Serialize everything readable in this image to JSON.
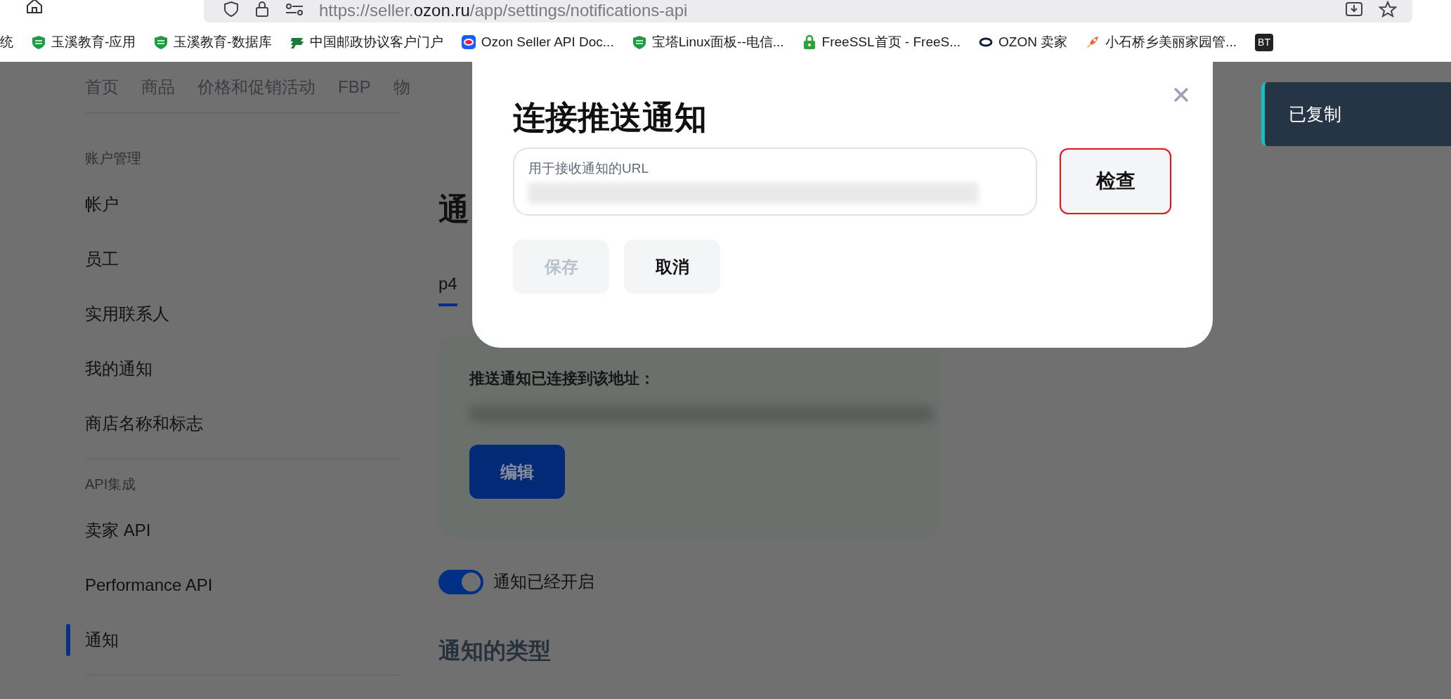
{
  "browser": {
    "url": {
      "prefix": "https://seller.",
      "domain": "ozon.ru",
      "path": "/app/settings/notifications-api"
    }
  },
  "bookmarks": [
    {
      "label": "统",
      "kind": "none"
    },
    {
      "label": "玉溪教育-应用",
      "kind": "shield"
    },
    {
      "label": "玉溪教育-数据库",
      "kind": "shield"
    },
    {
      "label": "中国邮政协议客户门户",
      "kind": "post"
    },
    {
      "label": "Ozon Seller API Doc...",
      "kind": "app"
    },
    {
      "label": "宝塔Linux面板--电信...",
      "kind": "shield"
    },
    {
      "label": "FreeSSL首页 - FreeS...",
      "kind": "lock"
    },
    {
      "label": "OZON 卖家",
      "kind": "ring"
    },
    {
      "label": "小石桥乡美丽家园管...",
      "kind": "rocket"
    },
    {
      "label": "BT",
      "kind": "tile"
    }
  ],
  "top_nav": [
    "首页",
    "商品",
    "价格和促销活动",
    "FBP",
    "物"
  ],
  "sidebar": [
    {
      "heading": "账户管理",
      "items": [
        {
          "label": "帐户",
          "selected": false
        },
        {
          "label": "员工",
          "selected": false
        },
        {
          "label": "实用联系人",
          "selected": false
        },
        {
          "label": "我的通知",
          "selected": false
        },
        {
          "label": "商店名称和标志",
          "selected": false
        }
      ]
    },
    {
      "heading": "API集成",
      "items": [
        {
          "label": "卖家 API",
          "selected": false
        },
        {
          "label": "Performance API",
          "selected": false
        },
        {
          "label": "通知",
          "selected": true
        }
      ]
    }
  ],
  "page": {
    "title": "通",
    "tabs": [
      {
        "label": "p4",
        "selected": true
      }
    ],
    "card": {
      "heading": "推送通知已连接到该地址：",
      "button": "编辑"
    },
    "toggle": {
      "label": "通知已经开启",
      "on": true
    },
    "section_title": "通知的类型"
  },
  "modal": {
    "title": "连接推送通知",
    "field": {
      "label": "用于接收通知的URL"
    },
    "check_button": {
      "label": "检查",
      "highlighted": true
    },
    "buttons": [
      {
        "label": "保存",
        "disabled": true
      },
      {
        "label": "取消",
        "disabled": false
      }
    ]
  },
  "toast": {
    "text": "已复制"
  }
}
